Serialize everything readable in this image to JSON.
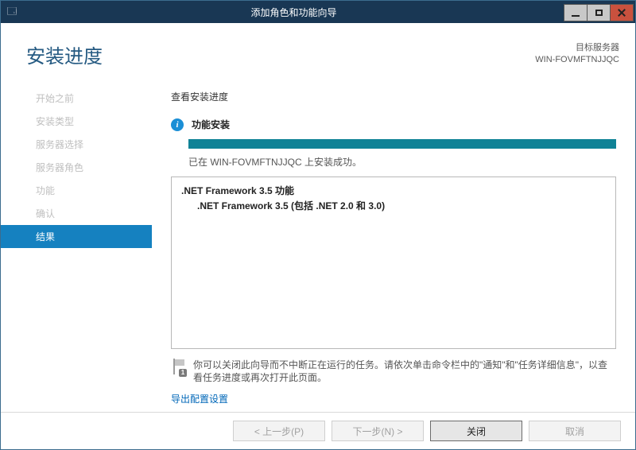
{
  "window": {
    "title": "添加角色和功能向导"
  },
  "header": {
    "page_title": "安装进度",
    "destination_label": "目标服务器",
    "destination_value": "WIN-FOVMFTNJJQC"
  },
  "sidebar": {
    "items": [
      {
        "label": "开始之前",
        "active": false
      },
      {
        "label": "安装类型",
        "active": false
      },
      {
        "label": "服务器选择",
        "active": false
      },
      {
        "label": "服务器角色",
        "active": false
      },
      {
        "label": "功能",
        "active": false
      },
      {
        "label": "确认",
        "active": false
      },
      {
        "label": "结果",
        "active": true
      }
    ]
  },
  "content": {
    "sub_heading": "查看安装进度",
    "info_icon": "i",
    "info_label": "功能安装",
    "progress_pct": 100,
    "progress_msg": "已在 WIN-FOVMFTNJJQC 上安装成功。",
    "result_lines": {
      "l1": ".NET Framework 3.5 功能",
      "l2": ".NET Framework 3.5 (包括 .NET 2.0 和 3.0)"
    },
    "hint_badge": "1",
    "hint_text": "你可以关闭此向导而不中断正在运行的任务。请依次单击命令栏中的\"通知\"和\"任务详细信息\"，以查看任务进度或再次打开此页面。",
    "export_link": "导出配置设置"
  },
  "footer": {
    "prev": "< 上一步(P)",
    "next": "下一步(N) >",
    "close": "关闭",
    "cancel": "取消"
  }
}
